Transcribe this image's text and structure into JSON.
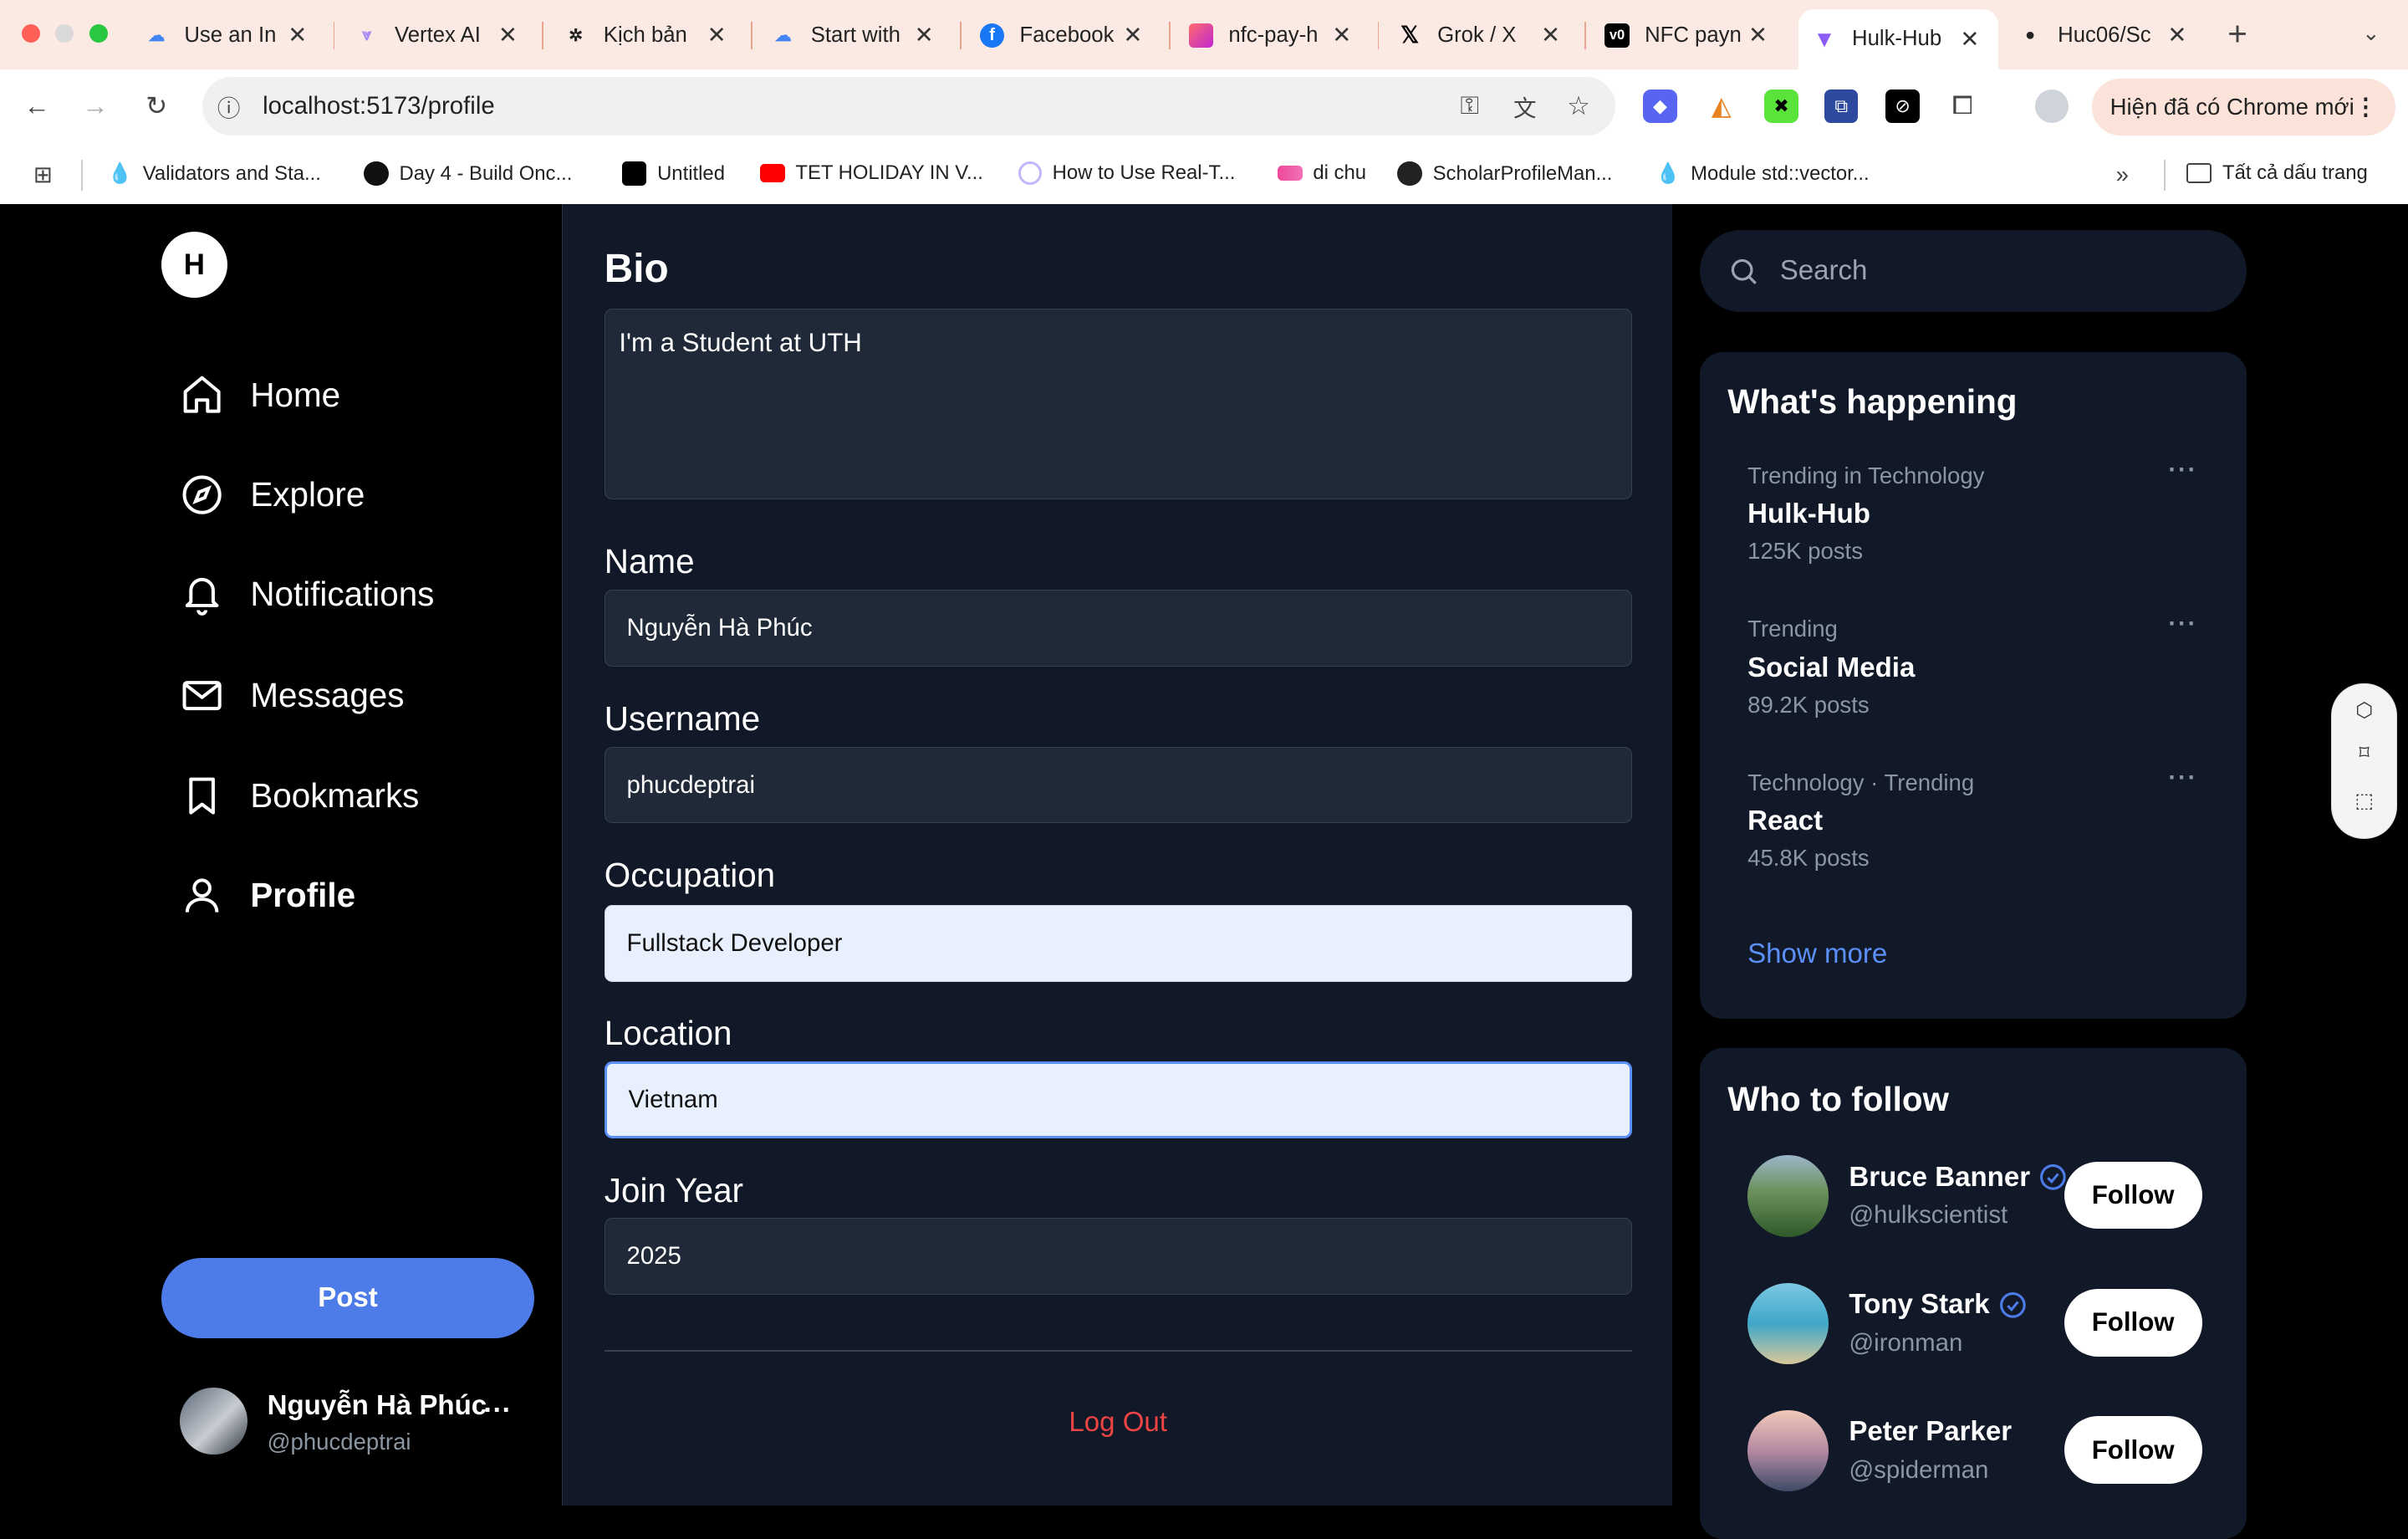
{
  "browser": {
    "tabs": [
      {
        "label": "Use an In",
        "favicon_color": "#4285f4",
        "favicon_icon": "google-cloud-icon"
      },
      {
        "label": "Vertex AI",
        "favicon_color": "#a78bfa",
        "favicon_icon": "vertex-icon"
      },
      {
        "label": "Kịch bản",
        "favicon_color": "#222222",
        "favicon_icon": "openai-icon"
      },
      {
        "label": "Start with",
        "favicon_color": "#4285f4",
        "favicon_icon": "google-cloud-icon"
      },
      {
        "label": "Facebook",
        "favicon_color": "#1877f2",
        "favicon_icon": "facebook-icon"
      },
      {
        "label": "nfc-pay-h",
        "favicon_color": "#e040fb",
        "favicon_icon": "lovable-icon"
      },
      {
        "label": "Grok / X",
        "favicon_color": "#000000",
        "favicon_icon": "x-icon"
      },
      {
        "label": "NFC payn",
        "favicon_color": "#000000",
        "favicon_icon": "v0-icon"
      },
      {
        "label": "Hulk-Hub",
        "favicon_color": "#8b5cf6",
        "favicon_icon": "vite-icon"
      },
      {
        "label": "Huc06/Sc",
        "favicon_color": "#222222",
        "favicon_icon": "github-icon"
      }
    ],
    "active_tab_index": 8,
    "url": "localhost:5173/profile",
    "update_button": "Hiện đã có Chrome mới",
    "bookmarks": [
      {
        "label": "Validators and Sta...",
        "icon": "drop-icon"
      },
      {
        "label": "Day 4 - Build Onc...",
        "icon": "doc-icon"
      },
      {
        "label": "Untitled",
        "icon": "grid-logo-icon"
      },
      {
        "label": "TET HOLIDAY IN V...",
        "icon": "youtube-icon"
      },
      {
        "label": "How to Use Real-T...",
        "icon": "link-icon"
      },
      {
        "label": "di chu",
        "icon": "chart-icon"
      },
      {
        "label": "ScholarProfileMan...",
        "icon": "github-icon"
      },
      {
        "label": "Module std::vector...",
        "icon": "drop-icon"
      }
    ],
    "all_bookmarks": "Tất cả dấu trang"
  },
  "app": {
    "logo_letter": "H",
    "nav": [
      {
        "label": "Home",
        "icon": "home-icon"
      },
      {
        "label": "Explore",
        "icon": "compass-icon"
      },
      {
        "label": "Notifications",
        "icon": "bell-icon"
      },
      {
        "label": "Messages",
        "icon": "mail-icon"
      },
      {
        "label": "Bookmarks",
        "icon": "bookmark-icon"
      },
      {
        "label": "Profile",
        "icon": "user-icon"
      }
    ],
    "active_nav": "Profile",
    "post_button": "Post",
    "current_user": {
      "name": "Nguyễn Hà Phúc",
      "handle": "@phucdeptrai",
      "more": "..."
    }
  },
  "form": {
    "bio_label": "Bio",
    "bio_value": "I'm a Student at UTH",
    "name_label": "Name",
    "name_value": "Nguyễn Hà Phúc",
    "username_label": "Username",
    "username_value": "phucdeptrai",
    "occupation_label": "Occupation",
    "occupation_value": "Fullstack Developer",
    "location_label": "Location",
    "location_value": "Vietnam",
    "join_year_label": "Join Year",
    "join_year_value": "2025",
    "logout": "Log Out"
  },
  "sidebar": {
    "search_placeholder": "Search",
    "happening_title": "What's happening",
    "trends": [
      {
        "category": "Trending in Technology",
        "title": "Hulk-Hub",
        "count": "125K posts"
      },
      {
        "category": "Trending",
        "title": "Social Media",
        "count": "89.2K posts"
      },
      {
        "category": "Technology · Trending",
        "title": "React",
        "count": "45.8K posts"
      }
    ],
    "trend_more": "···",
    "show_more": "Show more",
    "follow_title": "Who to follow",
    "follow_label": "Follow",
    "people": [
      {
        "name": "Bruce Banner",
        "handle": "@hulkscientist",
        "verified": true
      },
      {
        "name": "Tony Stark",
        "handle": "@ironman",
        "verified": true
      },
      {
        "name": "Peter Parker",
        "handle": "@spiderman",
        "verified": false
      }
    ]
  },
  "colors": {
    "accent": "#4d7ce8",
    "danger": "#ef4444",
    "panel": "#111827",
    "input": "#1f2937"
  }
}
